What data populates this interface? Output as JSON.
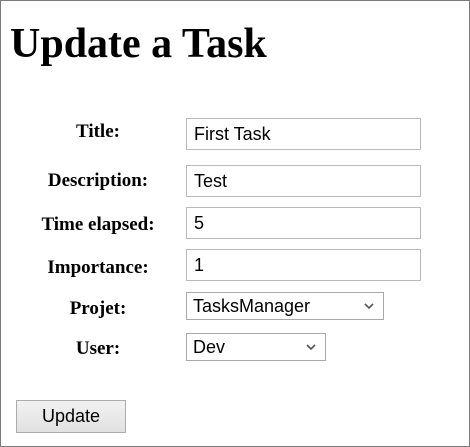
{
  "page": {
    "title": "Update a Task"
  },
  "form": {
    "title_label": "Title:",
    "title_value": "First Task",
    "description_label": "Description:",
    "description_value": "Test",
    "time_label": "Time elapsed:",
    "time_value": "5",
    "importance_label": "Importance:",
    "importance_value": "1",
    "project_label": "Projet:",
    "project_selected": "TasksManager",
    "user_label": "User:",
    "user_selected": "Dev",
    "submit_label": "Update"
  },
  "icons": {
    "dropdown": "chevron-down-icon"
  }
}
